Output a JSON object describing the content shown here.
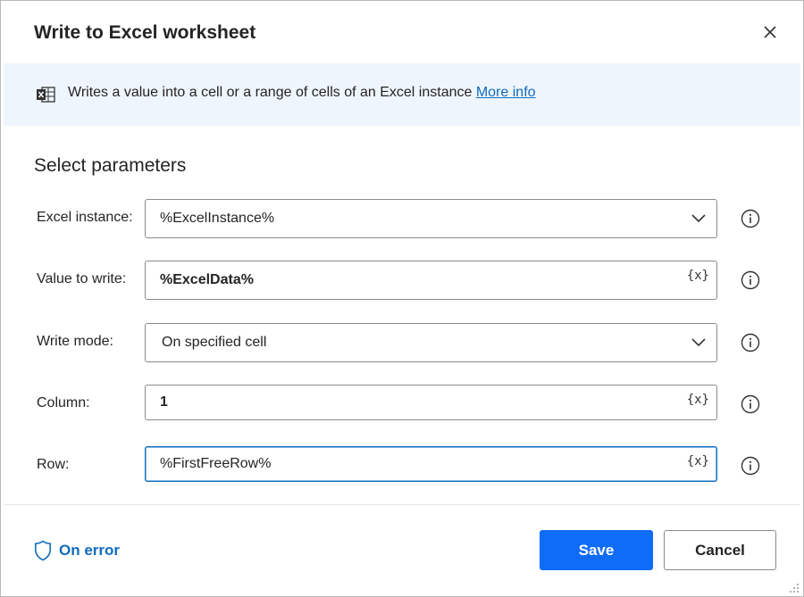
{
  "dialog": {
    "title": "Write to Excel worksheet"
  },
  "info": {
    "description": "Writes a value into a cell or a range of cells of an Excel instance",
    "link_label": "More info",
    "icon": "excel-icon"
  },
  "parameters": {
    "section_title": "Select parameters",
    "excel_instance": {
      "label": "Excel instance:",
      "value": "%ExcelInstance%"
    },
    "value_to_write": {
      "label": "Value to write:",
      "value": "%ExcelData%"
    },
    "write_mode": {
      "label": "Write mode:",
      "value": "On specified cell"
    },
    "column": {
      "label": "Column:",
      "value": "1"
    },
    "row": {
      "label": "Row:",
      "value": "%FirstFreeRow%"
    },
    "variable_button_label": "{x}"
  },
  "footer": {
    "on_error_label": "On error",
    "save_label": "Save",
    "cancel_label": "Cancel"
  },
  "colors": {
    "accent": "#0f6cbd",
    "save_button": "#0f6cf6",
    "info_bar_bg": "#eff5fc"
  }
}
